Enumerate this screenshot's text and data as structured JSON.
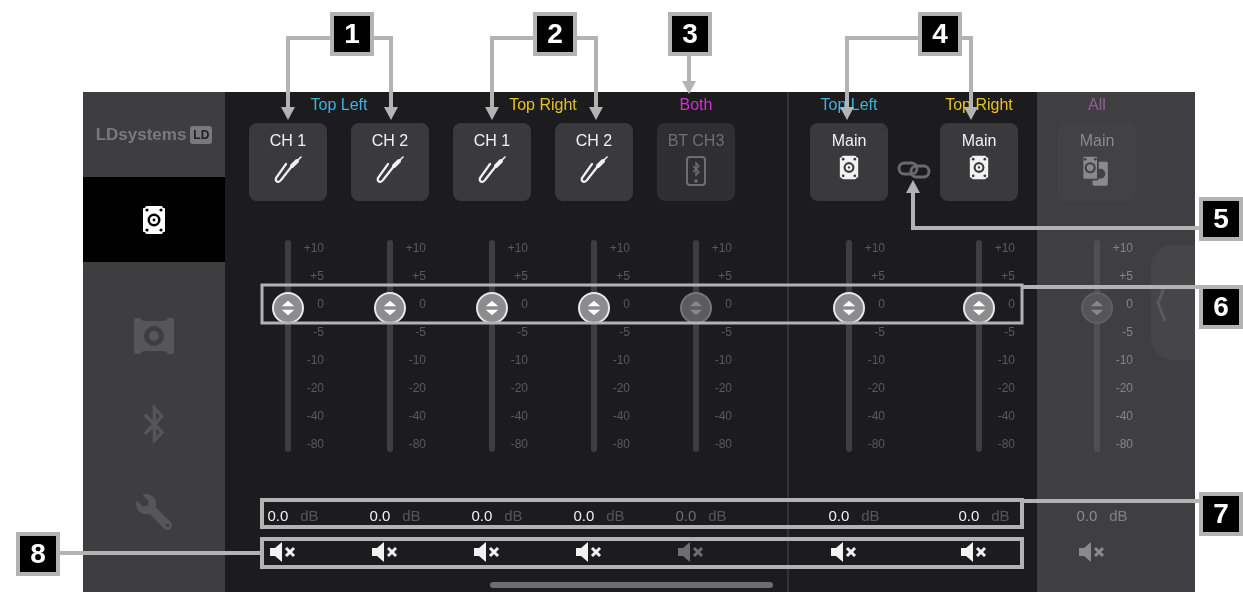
{
  "sidebar": {
    "logo": "LDsystems",
    "logo_badge": "LD",
    "items": [
      {
        "kind": "speaker",
        "selected": true
      },
      {
        "kind": "speaker-outline",
        "selected": false
      },
      {
        "kind": "bluetooth",
        "selected": false
      },
      {
        "kind": "wrench",
        "selected": false
      }
    ]
  },
  "inputs": {
    "groups": [
      {
        "label": "Top Left",
        "color": "#3fb3e0",
        "channels": [
          {
            "name": "CH 1",
            "kind": "jack",
            "disabled": false,
            "level": 0.68,
            "value": "0.0",
            "unit": "dB",
            "scale": [
              "+10",
              "+5",
              "0",
              "-5",
              "-10",
              "-20",
              "-40",
              "-80"
            ]
          },
          {
            "name": "CH 2",
            "kind": "jack",
            "disabled": false,
            "level": 0.68,
            "value": "0.0",
            "unit": "dB",
            "scale": [
              "+10",
              "+5",
              "0",
              "-5",
              "-10",
              "-20",
              "-40",
              "-80"
            ]
          }
        ]
      },
      {
        "label": "Top Right",
        "color": "#e6c229",
        "channels": [
          {
            "name": "CH 1",
            "kind": "jack",
            "disabled": false,
            "level": 0.68,
            "value": "0.0",
            "unit": "dB",
            "scale": [
              "+10",
              "+5",
              "0",
              "-5",
              "-10",
              "-20",
              "-40",
              "-80"
            ]
          },
          {
            "name": "CH 2",
            "kind": "jack",
            "disabled": false,
            "level": 0.68,
            "value": "0.0",
            "unit": "dB",
            "scale": [
              "+10",
              "+5",
              "0",
              "-5",
              "-10",
              "-20",
              "-40",
              "-80"
            ]
          }
        ]
      },
      {
        "label": "Both",
        "color": "#d42fd4",
        "channels": [
          {
            "name": "BT CH3",
            "kind": "phone",
            "disabled": true,
            "level": 0.68,
            "value": "0.0",
            "unit": "dB",
            "scale": [
              "+10",
              "+5",
              "0",
              "-5",
              "-10",
              "-20",
              "-40",
              "-80"
            ]
          }
        ]
      }
    ]
  },
  "outputs": {
    "linked": true,
    "groups": [
      {
        "label": "Top Left",
        "color": "#3fb3e0",
        "channels": [
          {
            "name": "Main",
            "kind": "speaker",
            "disabled": false,
            "level": 0.68,
            "value": "0.0",
            "unit": "dB",
            "scale": [
              "+10",
              "+5",
              "0",
              "-5",
              "-10",
              "-20",
              "-40",
              "-80"
            ]
          }
        ]
      },
      {
        "label": "Top Right",
        "color": "#e6c229",
        "channels": [
          {
            "name": "Main",
            "kind": "speaker",
            "disabled": false,
            "level": 0.68,
            "value": "0.0",
            "unit": "dB",
            "scale": [
              "+10",
              "+5",
              "0",
              "-5",
              "-10",
              "-20",
              "-40",
              "-80"
            ]
          }
        ]
      }
    ]
  },
  "all": {
    "label": "All",
    "color": "#9a5a9e",
    "channels": [
      {
        "name": "Main",
        "kind": "speaker-pair",
        "disabled": true,
        "level": 0.68,
        "value": "0.0",
        "unit": "dB",
        "scale": [
          "+10",
          "+5",
          "0",
          "-5",
          "-10",
          "-20",
          "-40",
          "-80"
        ]
      }
    ]
  },
  "callouts": [
    {
      "label": "1"
    },
    {
      "label": "2"
    },
    {
      "label": "3"
    },
    {
      "label": "4"
    },
    {
      "label": "5"
    },
    {
      "label": "6"
    },
    {
      "label": "7"
    },
    {
      "label": "8"
    }
  ]
}
